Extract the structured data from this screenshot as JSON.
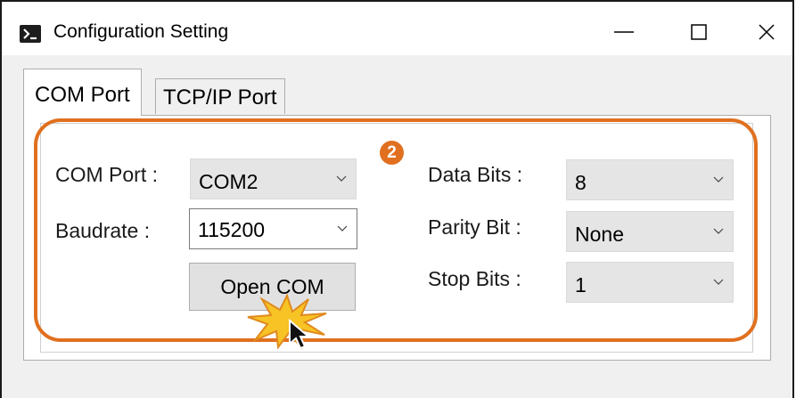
{
  "window": {
    "title": "Configuration Setting"
  },
  "tabs": [
    {
      "label": "COM Port",
      "active": true
    },
    {
      "label": "TCP/IP Port",
      "active": false
    }
  ],
  "step_badge": "2",
  "com_settings": {
    "com_port_label": "COM Port :",
    "com_port_value": "COM2",
    "baudrate_label": "Baudrate :",
    "baudrate_value": "115200",
    "open_button_label": "Open COM"
  },
  "serial_settings": {
    "data_bits_label": "Data Bits :",
    "data_bits_value": "8",
    "parity_bit_label": "Parity Bit :",
    "parity_bit_value": "None",
    "stop_bits_label": "Stop Bits :",
    "stop_bits_value": "1"
  },
  "icons": {
    "app": "terminal-icon",
    "minimize": "minimize-icon",
    "maximize": "maximize-icon",
    "close": "close-icon",
    "dropdown": "chevron-down-icon",
    "click_burst": "click-burst-icon",
    "cursor": "mouse-pointer-icon"
  },
  "colors": {
    "highlight": "#e0701f",
    "burst": "#f7c325",
    "readonly_field": "#e5e5e5",
    "window_bg": "#f0f0f0"
  }
}
